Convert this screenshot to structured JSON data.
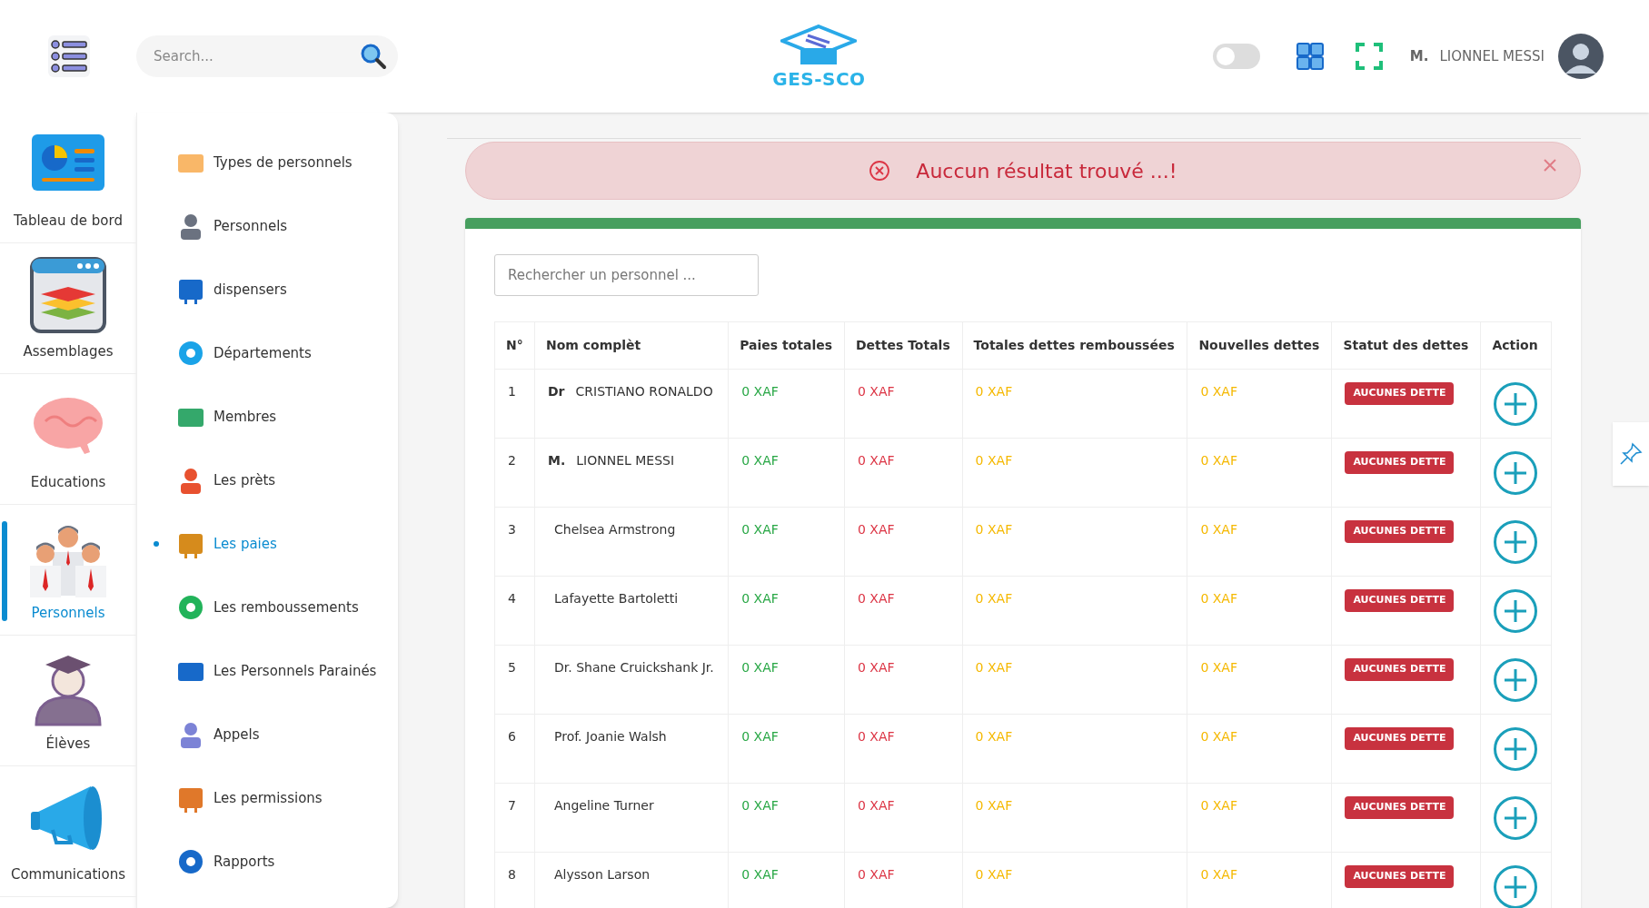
{
  "header": {
    "search": {
      "placeholder": "Search..."
    },
    "logo": "GES-SCO",
    "theme_toggle": {
      "on": false
    },
    "user": {
      "title": "M.",
      "name": "LIONNEL MESSI"
    }
  },
  "sidebar": {
    "items": [
      {
        "label": "Tableau de bord",
        "selected": false
      },
      {
        "label": "Assemblages",
        "selected": false
      },
      {
        "label": "Educations",
        "selected": false
      },
      {
        "label": "Personnels",
        "selected": true
      },
      {
        "label": "Élèves",
        "selected": false
      },
      {
        "label": "Communications",
        "selected": false
      }
    ]
  },
  "submenu": {
    "items": [
      {
        "label": "Types de personnels",
        "selected": false
      },
      {
        "label": "Personnels",
        "selected": false
      },
      {
        "label": "dispensers",
        "selected": false
      },
      {
        "label": "Départements",
        "selected": false
      },
      {
        "label": "Membres",
        "selected": false
      },
      {
        "label": "Les prèts",
        "selected": false
      },
      {
        "label": "Les paies",
        "selected": true
      },
      {
        "label": "Les remboussements",
        "selected": false
      },
      {
        "label": "Les Personnels Parainés",
        "selected": false
      },
      {
        "label": "Appels",
        "selected": false
      },
      {
        "label": "Les permissions",
        "selected": false
      },
      {
        "label": "Rapports",
        "selected": false
      }
    ]
  },
  "alert": {
    "message": "Auccun résultat trouvé ...!"
  },
  "search": {
    "placeholder": "Rechercher un personnel ..."
  },
  "table": {
    "columns": [
      "N°",
      "Nom complèt",
      "Paies totales",
      "Dettes Totals",
      "Totales dettes remboussées",
      "Nouvelles dettes",
      "Statut des dettes",
      "Action"
    ],
    "rows": [
      {
        "n": "1",
        "title": "Dr",
        "name": "CRISTIANO RONALDO",
        "paies": "0 XAF",
        "dettes": "0 XAF",
        "rembourse": "0 XAF",
        "nouvelles": "0 XAF",
        "statut": "AUCUNES DETTE"
      },
      {
        "n": "2",
        "title": "M.",
        "name": "LIONNEL MESSI",
        "paies": "0 XAF",
        "dettes": "0 XAF",
        "rembourse": "0 XAF",
        "nouvelles": "0 XAF",
        "statut": "AUCUNES DETTE"
      },
      {
        "n": "3",
        "name": "Chelsea Armstrong",
        "paies": "0 XAF",
        "dettes": "0 XAF",
        "rembourse": "0 XAF",
        "nouvelles": "0 XAF",
        "statut": "AUCUNES DETTE"
      },
      {
        "n": "4",
        "name": "Lafayette Bartoletti",
        "paies": "0 XAF",
        "dettes": "0 XAF",
        "rembourse": "0 XAF",
        "nouvelles": "0 XAF",
        "statut": "AUCUNES DETTE"
      },
      {
        "n": "5",
        "name": "Dr. Shane Cruickshank Jr.",
        "paies": "0 XAF",
        "dettes": "0 XAF",
        "rembourse": "0 XAF",
        "nouvelles": "0 XAF",
        "statut": "AUCUNES DETTE"
      },
      {
        "n": "6",
        "name": "Prof. Joanie Walsh",
        "paies": "0 XAF",
        "dettes": "0 XAF",
        "rembourse": "0 XAF",
        "nouvelles": "0 XAF",
        "statut": "AUCUNES DETTE"
      },
      {
        "n": "7",
        "name": "Angeline Turner",
        "paies": "0 XAF",
        "dettes": "0 XAF",
        "rembourse": "0 XAF",
        "nouvelles": "0 XAF",
        "statut": "AUCUNES DETTE"
      },
      {
        "n": "8",
        "name": "Alysson Larson",
        "paies": "0 XAF",
        "dettes": "0 XAF",
        "rembourse": "0 XAF",
        "nouvelles": "0 XAF",
        "statut": "AUCUNES DETTE"
      }
    ]
  }
}
